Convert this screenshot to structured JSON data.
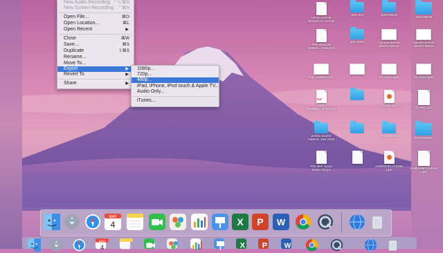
{
  "file_menu": {
    "items": [
      {
        "label": "New Audio Recording",
        "shortcut": "⌃⌥⌘N",
        "dim": false
      },
      {
        "label": "New Screen Recording",
        "shortcut": "⌃⌘N",
        "dim": true
      },
      {
        "label": "Open File...",
        "shortcut": "⌘O",
        "dim": false
      },
      {
        "label": "Open Location...",
        "shortcut": "⌘L",
        "dim": false
      },
      {
        "label": "Open Recent",
        "shortcut": "▶",
        "dim": false
      },
      {
        "label": "Close",
        "shortcut": "⌘W",
        "dim": false
      },
      {
        "label": "Save...",
        "shortcut": "⌘S",
        "dim": false
      },
      {
        "label": "Duplicate",
        "shortcut": "⇧⌘S",
        "dim": false
      },
      {
        "label": "Rename...",
        "shortcut": "",
        "dim": false
      },
      {
        "label": "Move To...",
        "shortcut": "",
        "dim": false
      },
      {
        "label": "Export",
        "shortcut": "▶",
        "dim": false,
        "highlighted": true
      },
      {
        "label": "Revert To",
        "shortcut": "▶",
        "dim": false
      },
      {
        "label": "Share",
        "shortcut": "▶",
        "dim": false
      }
    ]
  },
  "export_submenu": {
    "items": [
      {
        "label": "1080p..."
      },
      {
        "label": "720p..."
      },
      {
        "label": "480p...",
        "highlighted": true
      },
      {
        "label": "iPad, iPhone, iPod touch & Apple TV..."
      },
      {
        "label": "Audio Only..."
      },
      {
        "label": "iTunes..."
      }
    ]
  },
  "desktop_icons": {
    "col1": [
      {
        "label": "LEGE HATAN\nWATEN..N TETUN",
        "kind": "doc"
      },
      {
        "label": "THE MEMOS\nSIMBOL...MALAHA",
        "kind": "doc"
      },
      {
        "label": "lege COSMA.png",
        "kind": "thumb"
      },
      {
        "label": "NS3\nMONOG...N TETUN",
        "kind": "pdf"
      },
      {
        "label": "pontos exame\nmateria...ties 2019",
        "kind": "folder"
      },
      {
        "label": "Pos ideh Tycya\nlasaro-Tycya",
        "kind": "doc"
      }
    ],
    "col2": [
      {
        "label": "Jeto Heri",
        "kind": "folder"
      },
      {
        "label": "jeto Laure",
        "kind": "folder"
      },
      {
        "label": "",
        "kind": "thumb"
      },
      {
        "label": "",
        "kind": "folder"
      },
      {
        "label": "",
        "kind": "folder"
      },
      {
        "label": "",
        "kind": "doc"
      }
    ],
    "col3": [
      {
        "label": "100CANON",
        "kind": "folder"
      },
      {
        "label": "Agradecimento\nSenhor-Moras",
        "kind": "thumb"
      },
      {
        "label": "Arri aceci.pptx",
        "kind": "thumb"
      },
      {
        "label": "CLASS.docx",
        "kind": "ppt"
      },
      {
        "label": "DOCUMENT",
        "kind": "folder"
      },
      {
        "label": "JAMESNELYA3455\n.pptx",
        "kind": "ppt"
      }
    ],
    "col_edge": [
      {
        "label": "100CANON",
        "kind": "folder"
      },
      {
        "label": "Agradecimento\nSenhor-Maras",
        "kind": "thumb"
      },
      {
        "label": "Arri aceci.pptx",
        "kind": "thumb"
      },
      {
        "label": "CLASS.docx",
        "kind": "doc"
      },
      {
        "label": "DOCUMENT",
        "kind": "folder"
      },
      {
        "label": "JAMESNELYA3455\n.pptx",
        "kind": "doc"
      }
    ]
  },
  "dock": {
    "apps": [
      {
        "name": "Finder",
        "icon": "finder-icon",
        "color": "#3f8fe6"
      },
      {
        "name": "Launchpad",
        "icon": "rocket-icon",
        "color": "#8a8fa0"
      },
      {
        "name": "Safari",
        "icon": "compass-icon",
        "color": "#1e8ff0"
      },
      {
        "name": "Calendar",
        "icon": "calendar-icon",
        "color": "#ffffff",
        "text": "4",
        "month": "MAR"
      },
      {
        "name": "Notes",
        "icon": "notes-icon",
        "color": "#f6d54a"
      },
      {
        "name": "FaceTime",
        "icon": "video-icon",
        "color": "#2fbf4a"
      },
      {
        "name": "Photo Booth",
        "icon": "photos-icon",
        "color": "#d9a33a"
      },
      {
        "name": "Numbers",
        "icon": "bar-chart-icon",
        "color": "#35a84f"
      },
      {
        "name": "Keynote",
        "icon": "keynote-icon",
        "color": "#2f7fe0"
      },
      {
        "name": "Excel",
        "icon": "excel-icon",
        "color": "#1e7a45"
      },
      {
        "name": "PowerPoint",
        "icon": "powerpoint-icon",
        "color": "#d0452a"
      },
      {
        "name": "Word",
        "icon": "word-icon",
        "color": "#2b5fb4"
      },
      {
        "name": "Chrome",
        "icon": "chrome-icon",
        "color": "#ffffff"
      },
      {
        "name": "QuickTime",
        "icon": "quicktime-icon",
        "color": "#2b3a55"
      },
      {
        "name": "Network",
        "icon": "globe-icon",
        "color": "#2f7be0"
      },
      {
        "name": "Trash",
        "icon": "trash-icon",
        "color": "#dfe3ea"
      }
    ]
  },
  "colors": {
    "highlight": "#3b78d8",
    "menu_bg": "#ece9f0",
    "sky_top": "#c36ea6",
    "sky_mid": "#d98fb3",
    "mountain": "#8c5da5"
  }
}
